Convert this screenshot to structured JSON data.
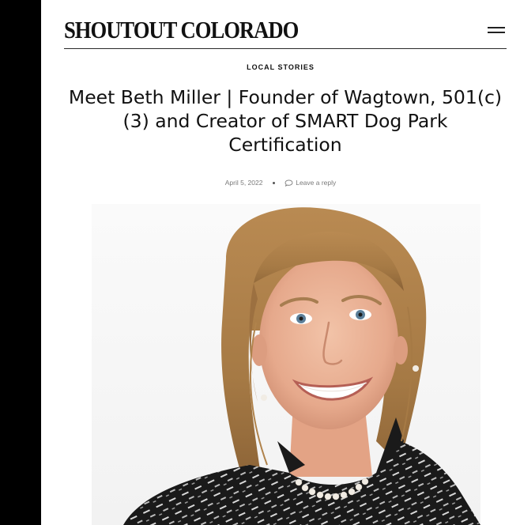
{
  "site": {
    "logo_text": "SHOUTOUT COLORADO"
  },
  "article": {
    "category": "LOCAL STORIES",
    "title": "Meet Beth Miller | Founder of Wagtown, 501(c)(3) and Creator of SMART Dog Park Certification",
    "date": "April 5, 2022",
    "reply_label": "Leave a reply"
  },
  "icons": {
    "menu": "hamburger-menu-icon",
    "comment": "speech-bubble-icon"
  },
  "colors": {
    "left_bar": "#000000",
    "text": "#111111",
    "meta": "#7a7a7a"
  }
}
